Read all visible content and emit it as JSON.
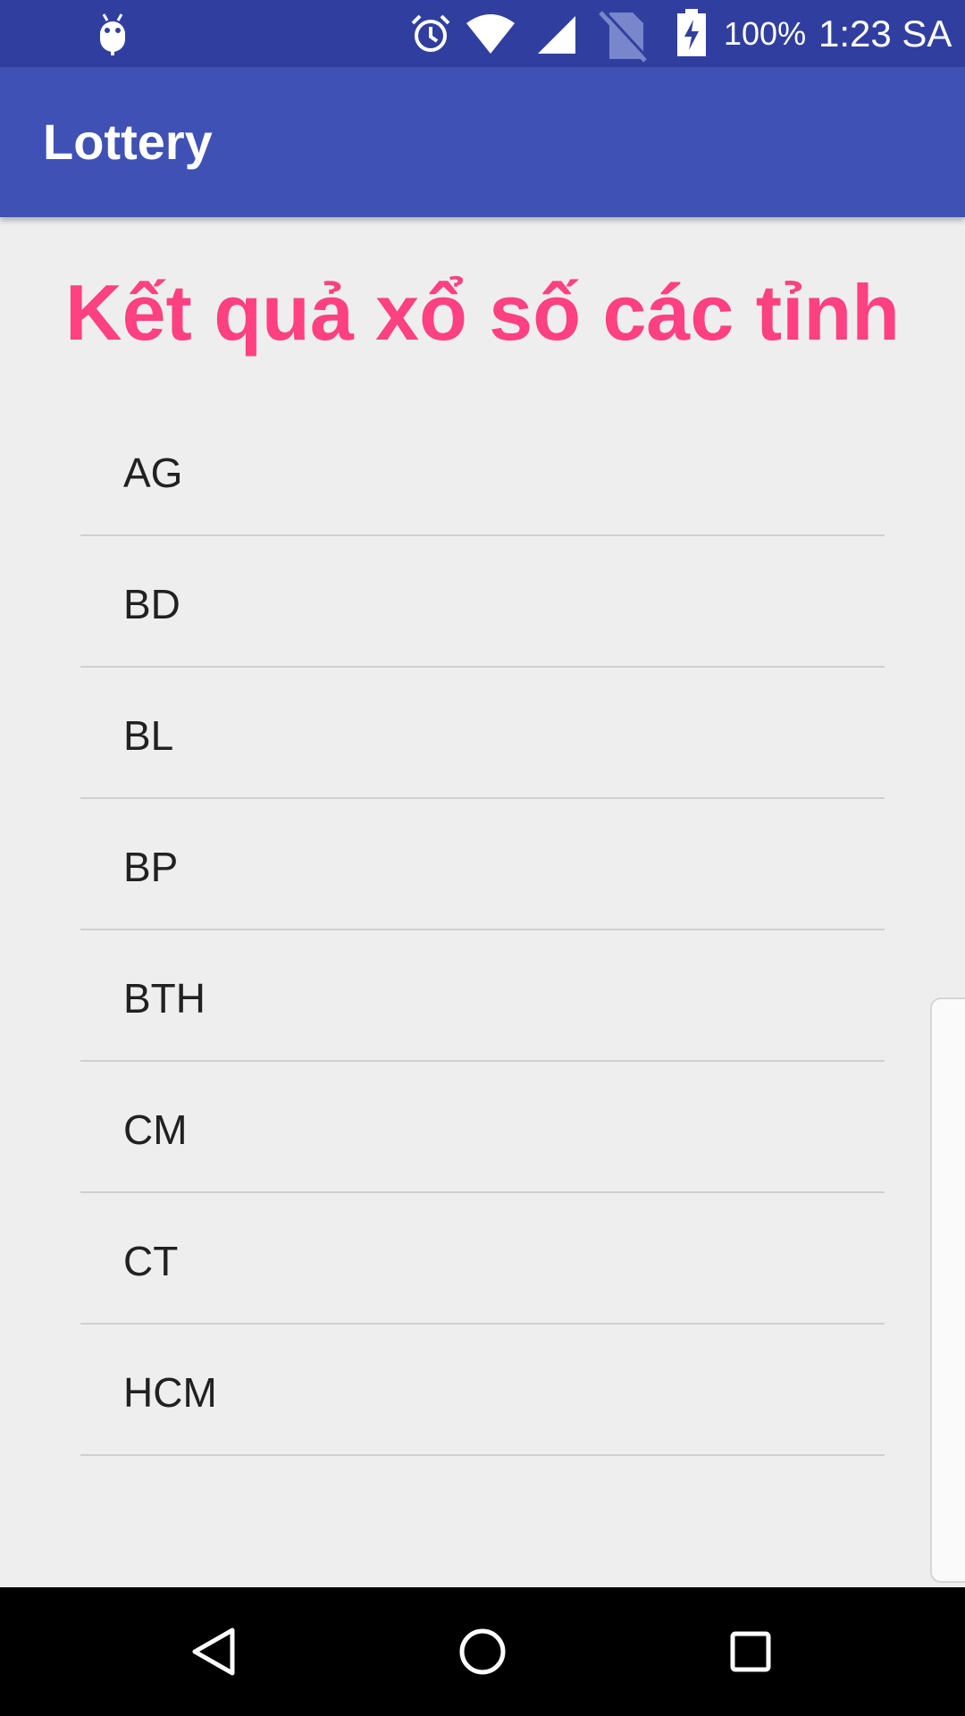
{
  "status_bar": {
    "battery_percent": "100%",
    "time": "1:23 SA",
    "icons": [
      "android-debug-icon",
      "alarm-icon",
      "wifi-icon",
      "cell-signal-icon",
      "no-sim-icon",
      "battery-charging-icon"
    ]
  },
  "app_bar": {
    "title": "Lottery",
    "color": "#3f51b5",
    "status_color": "#303f9f"
  },
  "main": {
    "heading": "Kết quả xổ số các tỉnh",
    "heading_color": "#ff4081",
    "provinces": [
      {
        "label": "AG"
      },
      {
        "label": "BD"
      },
      {
        "label": "BL"
      },
      {
        "label": "BP"
      },
      {
        "label": "BTH"
      },
      {
        "label": "CM"
      },
      {
        "label": "CT"
      },
      {
        "label": "HCM"
      }
    ]
  },
  "nav_bar": {
    "buttons": [
      "back-icon",
      "home-icon",
      "recents-icon"
    ]
  }
}
